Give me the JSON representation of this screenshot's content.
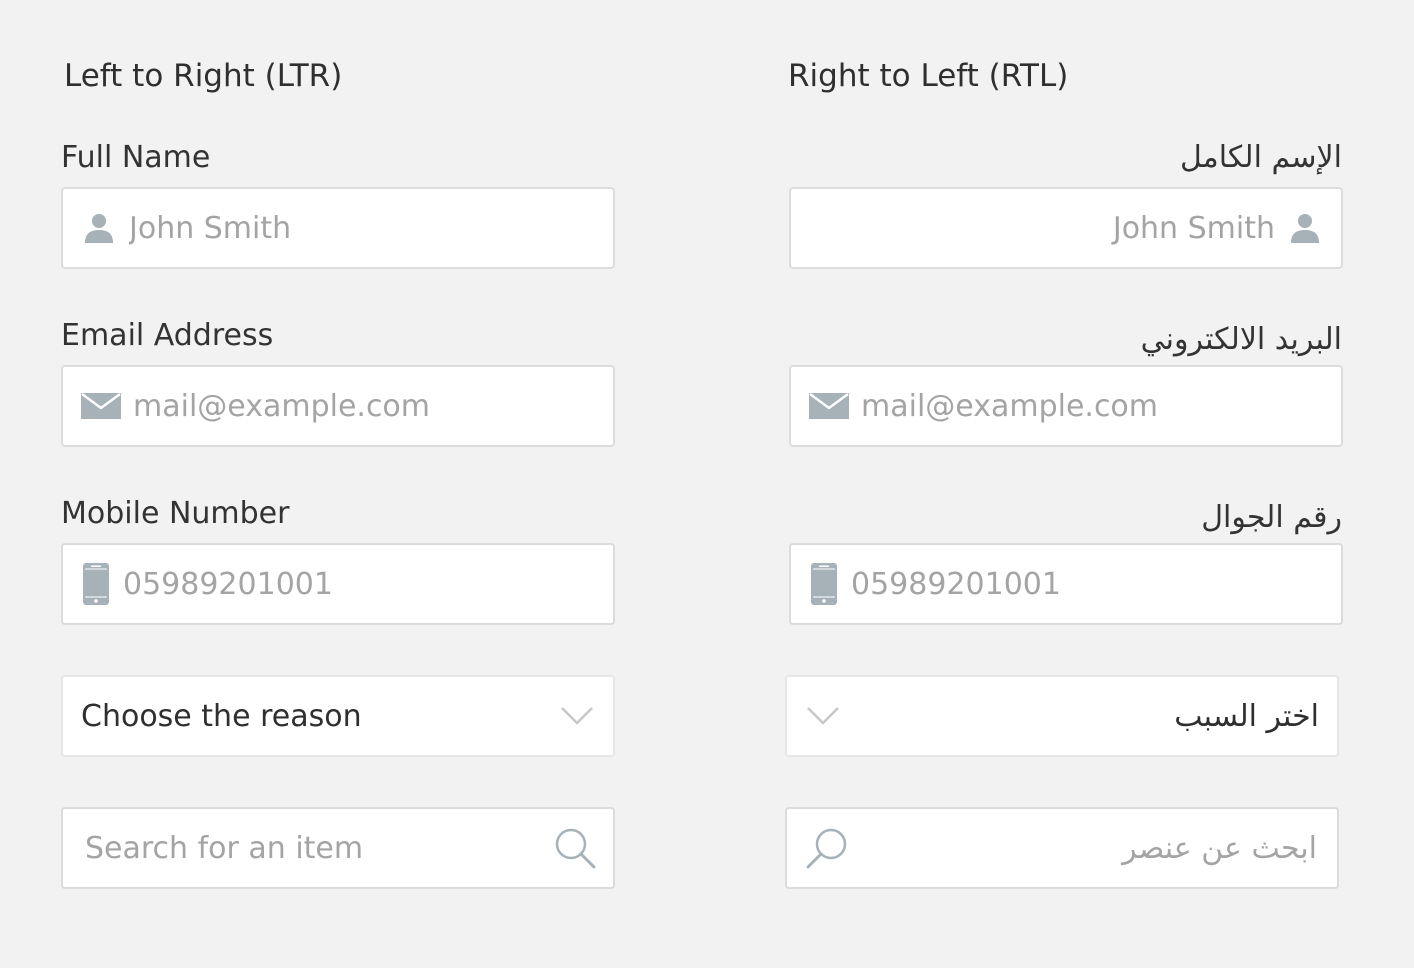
{
  "ltr": {
    "title": "Left to Right (LTR)",
    "full_name": {
      "label": "Full Name",
      "placeholder": "John Smith",
      "icon": "user-icon"
    },
    "email": {
      "label": "Email Address",
      "placeholder": "mail@example.com",
      "icon": "envelope-icon"
    },
    "mobile": {
      "label": "Mobile Number",
      "placeholder": "05989201001",
      "icon": "mobile-phone-icon"
    },
    "reason": {
      "value": "Choose the reason",
      "icon": "chevron-down-icon"
    },
    "search": {
      "placeholder": "Search for an item",
      "icon": "search-icon"
    }
  },
  "rtl": {
    "title": "Right to Left (RTL)",
    "full_name": {
      "label": "الإسم الكامل",
      "placeholder": "John Smith",
      "icon": "user-icon"
    },
    "email": {
      "label": "البريد الالكتروني",
      "placeholder": "mail@example.com",
      "icon": "envelope-icon"
    },
    "mobile": {
      "label": "رقم الجوال",
      "placeholder": "05989201001",
      "icon": "mobile-phone-icon"
    },
    "reason": {
      "value": "اختر السبب",
      "icon": "chevron-down-icon"
    },
    "search": {
      "placeholder": "ابحث عن عنصر",
      "icon": "search-icon"
    }
  },
  "colors": {
    "background": "#f2f2f2",
    "field_bg": "#ffffff",
    "border": "#dcdcdc",
    "icon": "#a7b1b8",
    "placeholder": "#a4a4a4",
    "text": "#333333"
  }
}
